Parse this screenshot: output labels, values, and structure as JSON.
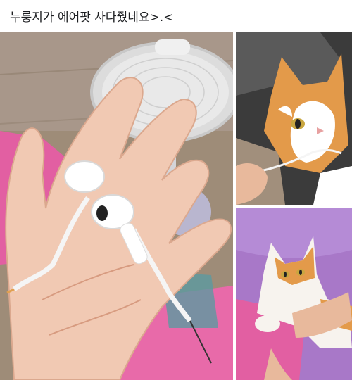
{
  "post": {
    "caption": "누룽지가 에어팟 사다줬네요>.<"
  },
  "photos": [
    {
      "subject": "Hand holding chewed earphones"
    },
    {
      "subject": "Orange and white cat biting earphone cable"
    },
    {
      "subject": "Cat lying on pink blanket held by hand"
    }
  ],
  "colors": {
    "background": "#ffffff",
    "text": "#1c1e21",
    "pink_blanket": "#e25fa2",
    "purple_blanket": "#a878c8",
    "floor_wood": "#a08f7c",
    "cat_orange": "#e39a4a"
  }
}
